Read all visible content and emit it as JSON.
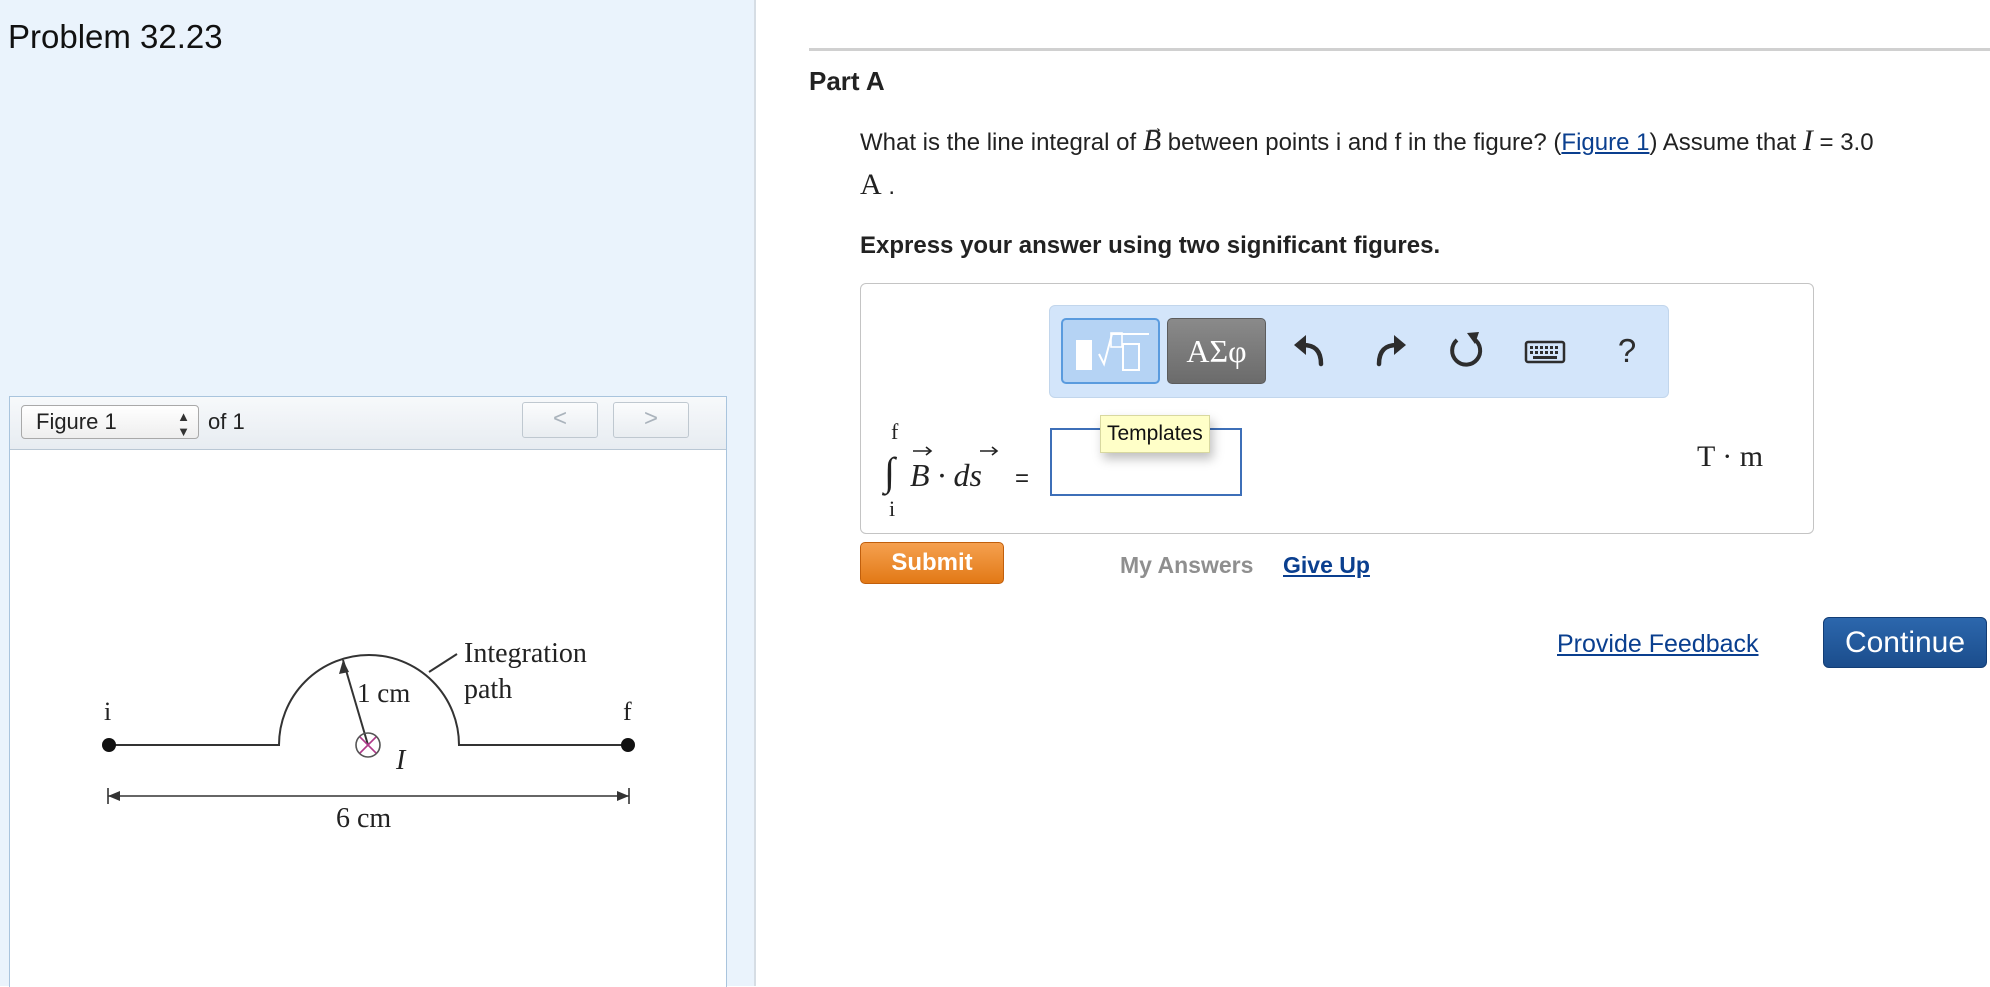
{
  "problem": {
    "title": "Problem 32.23"
  },
  "figure_panel": {
    "select_value": "Figure 1",
    "of_text": "of 1",
    "prev_label": "<",
    "next_label": ">",
    "labels": {
      "start": "i",
      "end": "f",
      "radius": "1 cm",
      "current": "I",
      "path_line1": "Integration",
      "path_line2": "path",
      "width": "6 cm"
    }
  },
  "part": {
    "title": "Part A",
    "question_before": "What is the line integral of ",
    "question_vec": "B",
    "question_middle": " between points i and f in the figure? (",
    "figure_link": "Figure 1",
    "question_after": ") Assume that ",
    "current_symbol": "I",
    "current_value": " = 3.0",
    "current_unit": "A",
    "period": " .",
    "instruction": "Express your answer using two significant figures."
  },
  "toolbar": {
    "greek_label": "ΑΣφ",
    "help_label": "?",
    "tooltip": "Templates",
    "icons": [
      "templates-icon",
      "undo-icon",
      "redo-icon",
      "reset-icon",
      "keyboard-icon"
    ]
  },
  "answer": {
    "integral_upper": "f",
    "integral_lower": "i",
    "integral_expr": "B · ds",
    "equals": "=",
    "input_value": "",
    "units": "T · m"
  },
  "actions": {
    "submit": "Submit",
    "my_answers": "My Answers",
    "give_up": "Give Up",
    "feedback": "Provide Feedback",
    "continue": "Continue"
  },
  "colors": {
    "left_panel_bg": "#eaf3fc",
    "link": "#0a3f8f",
    "submit": "#e88a2e",
    "continue": "#1f5599",
    "toolbar_bg": "#d3e5fa"
  }
}
